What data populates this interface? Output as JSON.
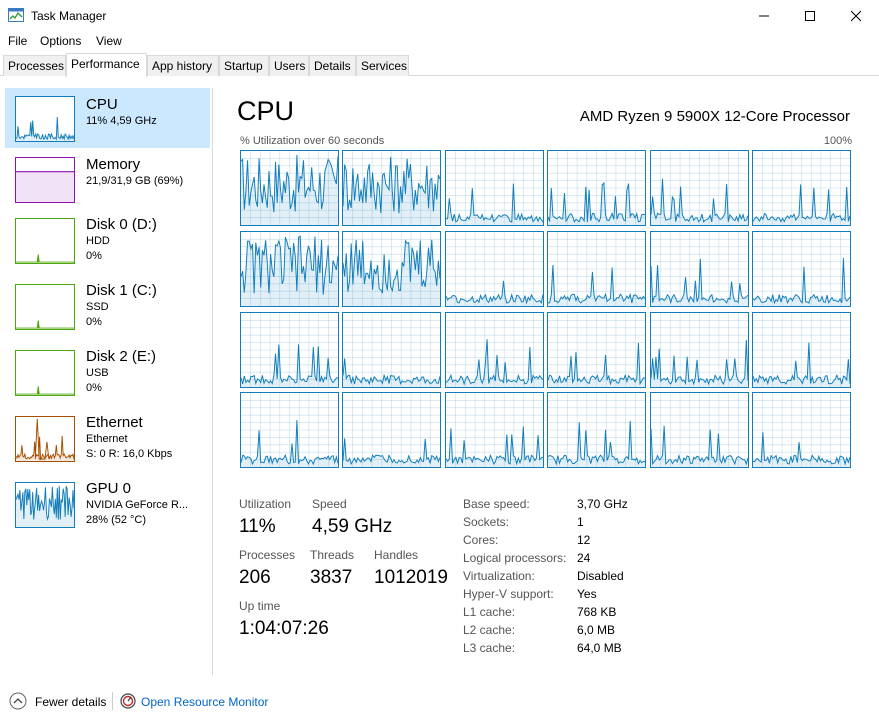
{
  "window": {
    "title": "Task Manager",
    "icon": "task-manager-icon",
    "controls": [
      "minimize-icon",
      "maximize-icon",
      "close-icon"
    ]
  },
  "menu": [
    "File",
    "Options",
    "View"
  ],
  "tabs": [
    "Processes",
    "Performance",
    "App history",
    "Startup",
    "Users",
    "Details",
    "Services"
  ],
  "active_tab": "Performance",
  "sidebar": [
    {
      "title": "CPU",
      "sub1": "11% 4,59 GHz",
      "sub2": "",
      "color": "#117dbb",
      "selected": true
    },
    {
      "title": "Memory",
      "sub1": "21,9/31,9 GB (69%)",
      "sub2": "",
      "color": "#8b12ae",
      "selected": false
    },
    {
      "title": "Disk 0 (D:)",
      "sub1": "HDD",
      "sub2": "0%",
      "color": "#4da60c",
      "selected": false
    },
    {
      "title": "Disk 1 (C:)",
      "sub1": "SSD",
      "sub2": "0%",
      "color": "#4da60c",
      "selected": false
    },
    {
      "title": "Disk 2 (E:)",
      "sub1": "USB",
      "sub2": "0%",
      "color": "#4da60c",
      "selected": false
    },
    {
      "title": "Ethernet",
      "sub1": "Ethernet",
      "sub2": "S: 0 R: 16,0 Kbps",
      "color": "#a74f01",
      "selected": false
    },
    {
      "title": "GPU 0",
      "sub1": "NVIDIA GeForce R...",
      "sub2": "28% (52 °C)",
      "color": "#117dbb",
      "selected": false
    }
  ],
  "main": {
    "title": "CPU",
    "cpu_name": "AMD Ryzen 9 5900X 12-Core Processor",
    "graph_caption": "% Utilization over 60 seconds",
    "graph_max": "100%",
    "core_count": 24,
    "accent": "#117dbb"
  },
  "stats": {
    "utilization_label": "Utilization",
    "utilization": "11%",
    "speed_label": "Speed",
    "speed": "4,59 GHz",
    "processes_label": "Processes",
    "processes": "206",
    "threads_label": "Threads",
    "threads": "3837",
    "handles_label": "Handles",
    "handles": "1012019",
    "uptime_label": "Up time",
    "uptime": "1:04:07:26"
  },
  "specs": [
    {
      "label": "Base speed:",
      "value": "3,70 GHz"
    },
    {
      "label": "Sockets:",
      "value": "1"
    },
    {
      "label": "Cores:",
      "value": "12"
    },
    {
      "label": "Logical processors:",
      "value": "24"
    },
    {
      "label": "Virtualization:",
      "value": "Disabled"
    },
    {
      "label": "Hyper-V support:",
      "value": "Yes"
    },
    {
      "label": "L1 cache:",
      "value": "768 KB"
    },
    {
      "label": "L2 cache:",
      "value": "6,0 MB"
    },
    {
      "label": "L3 cache:",
      "value": "64,0 MB"
    }
  ],
  "footer": {
    "fewer_details": "Fewer details",
    "resource_monitor": "Open Resource Monitor"
  }
}
